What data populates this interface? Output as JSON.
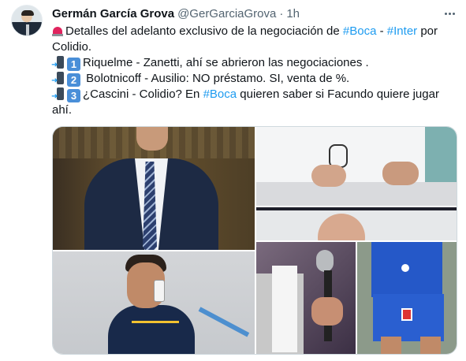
{
  "author": {
    "name": "Germán García Grova",
    "handle": "@GerGarciaGrova",
    "separator": "·",
    "time": "1h",
    "avatar_icon": "profile-photo"
  },
  "tweet": {
    "line1_pre": "Detalles del adelanto exclusivo de la negociación de ",
    "hashtag_boca": "#Boca",
    "dash": " - ",
    "hashtag_inter": "#Inter",
    "line1_post": " por",
    "line2": "Colidio.",
    "item1_num": "1",
    "item1_text": "Riquelme - Zanetti, ahí se abrieron las negociaciones .",
    "item2_num": "2",
    "item2_text": " Bolotnicoff - Ausilio: NO préstamo. SI, venta de %.",
    "item3_num": "3",
    "item3_pre": "¿Cascini - Colidio? En ",
    "item3_hashtag": "#Boca",
    "item3_post": " quieren saber si  Facundo quiere jugar",
    "line_last": "ahí.",
    "link_color": "#1d9bf0"
  },
  "icons": {
    "siren": "police-light-emoji",
    "phone": "phone-with-arrow-emoji",
    "more": "more-options-icon"
  }
}
